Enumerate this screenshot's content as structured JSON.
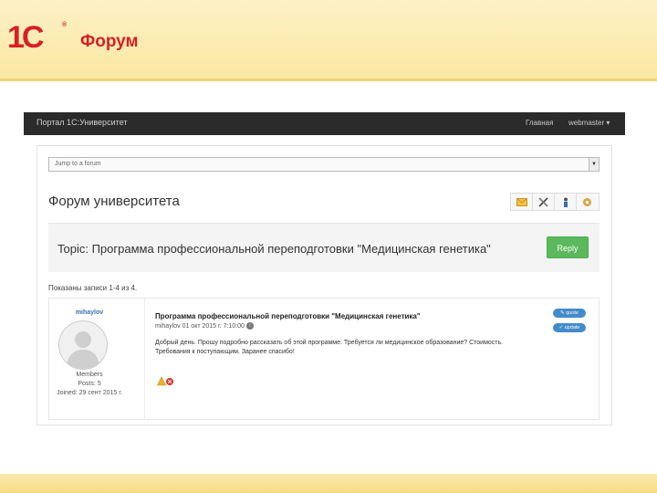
{
  "slide": {
    "logo": "1C",
    "logo_reg": "®",
    "title": "Форум"
  },
  "navbar": {
    "brand": "Портал 1С:Университет",
    "home": "Главная",
    "user": "webmaster ▾"
  },
  "forum": {
    "jump_placeholder": "Jump to a forum",
    "title": "Форум университета",
    "toolbar_icons": [
      "envelope-icon",
      "tools-icon",
      "person-icon",
      "gear-icon"
    ]
  },
  "topic": {
    "title": "Topic: Программа профессиональной переподготовки \"Медицинская генетика\"",
    "reply_label": "Reply",
    "records": "Показаны записи 1-4 из 4."
  },
  "post": {
    "username": "mihaylov",
    "role": "Members",
    "posts": "Posts: 5",
    "joined": "Joined: 29 сент 2015 г.",
    "title": "Программа профессиональной переподготовки \"Медицинская генетика\"",
    "meta": "mihaylov 01 окт 2015 г. 7:10:00",
    "body_line1": "Добрый день. Прошу подробно рассказать об этой программе. Требуется ли медицинское образование? Стоимость.",
    "body_line2": "Требования к поступающим. Заранее спасибо!",
    "quote_label": "quote",
    "update_label": "update"
  },
  "colors": {
    "brand_red": "#d81f26",
    "reply_green": "#5cb85c",
    "action_blue": "#428bca",
    "navbar_dark": "#2b2b2b"
  }
}
